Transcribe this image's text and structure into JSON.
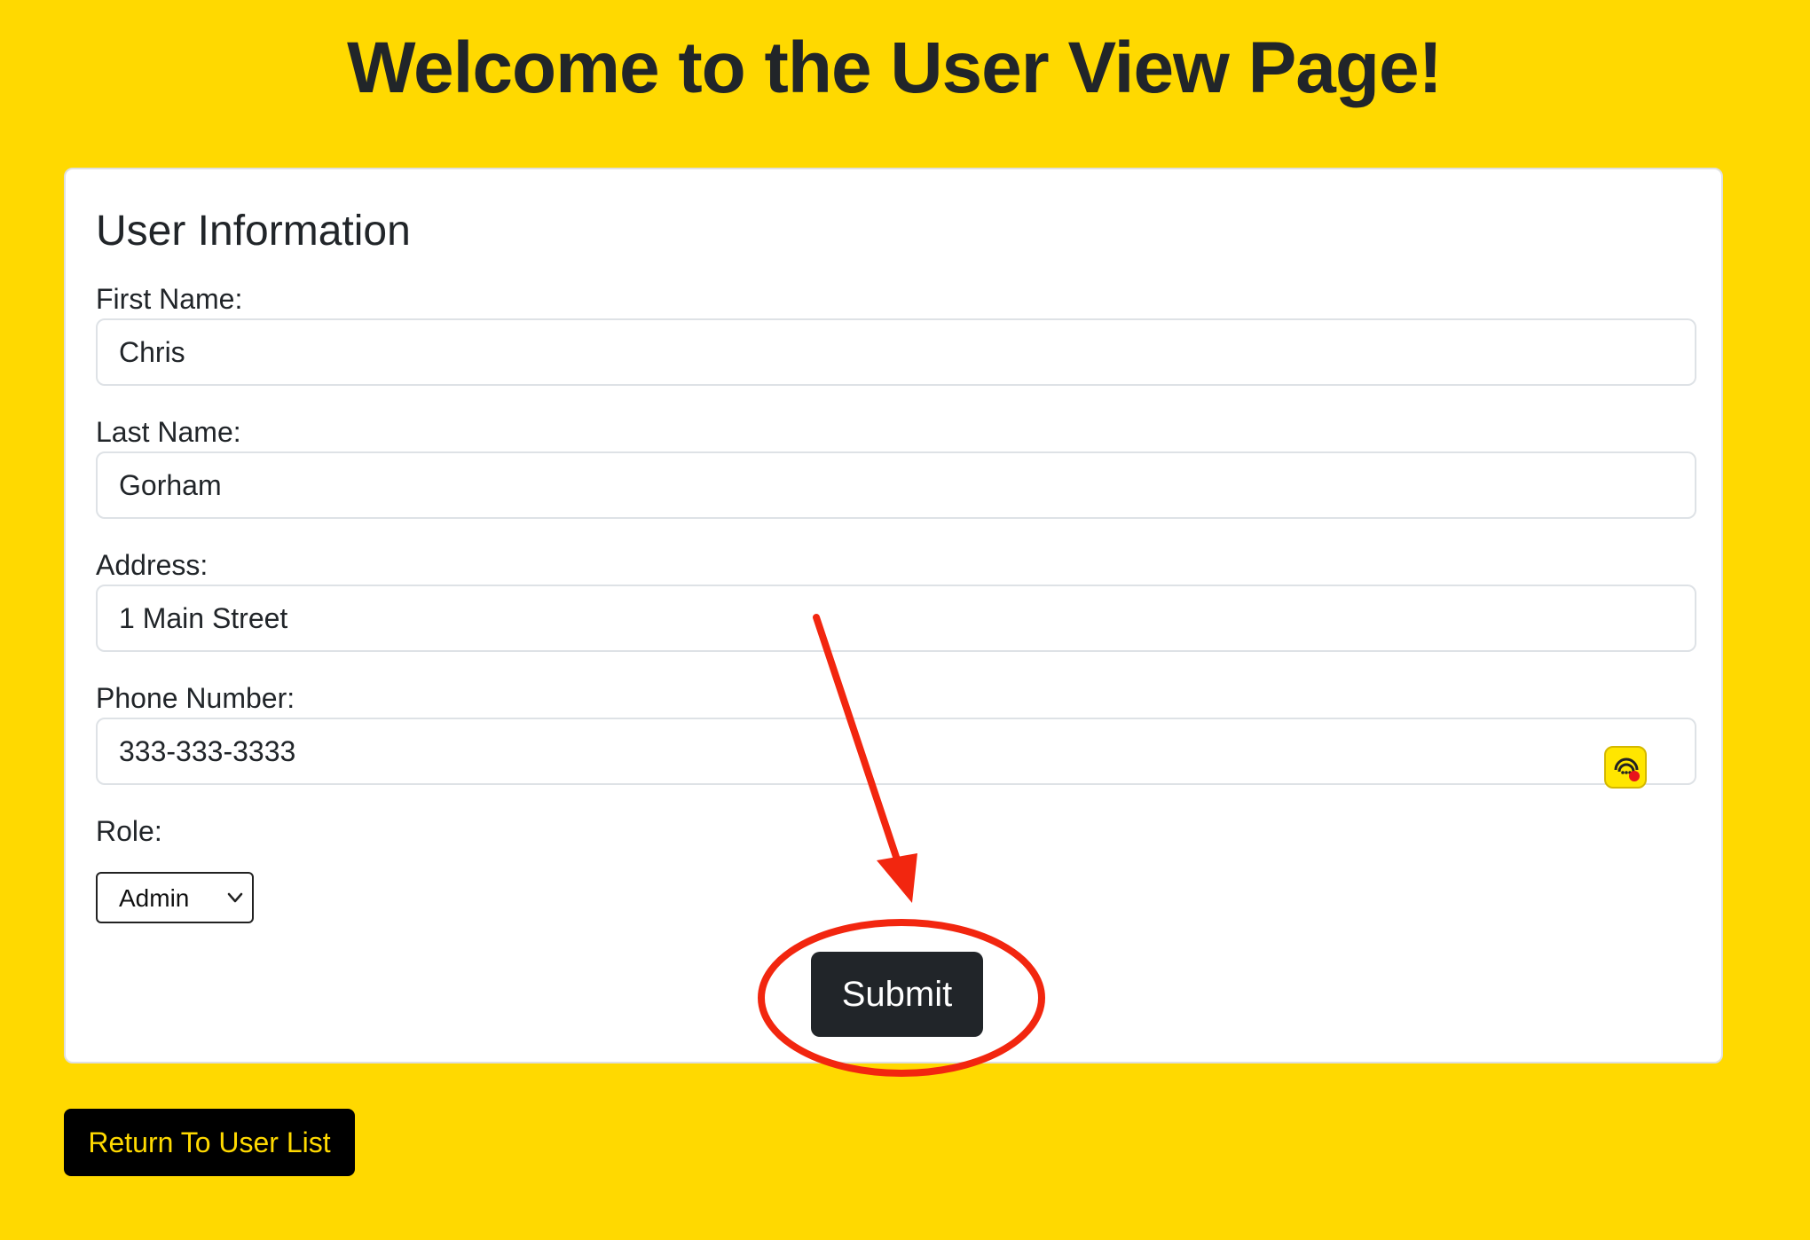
{
  "page": {
    "title": "Welcome to the User View Page!"
  },
  "card": {
    "title": "User Information",
    "fields": [
      {
        "label": "First Name:",
        "value": "Chris"
      },
      {
        "label": "Last Name:",
        "value": "Gorham"
      },
      {
        "label": "Address:",
        "value": "1 Main Street"
      },
      {
        "label": "Phone Number:",
        "value": "333-333-3333"
      }
    ],
    "role": {
      "label": "Role:",
      "selected": "Admin"
    },
    "submit_label": "Submit"
  },
  "footer": {
    "return_label": "Return To User List"
  },
  "colors": {
    "page_background": "#FFD900",
    "button_dark": "#212529",
    "return_button_bg": "#000000",
    "return_button_text": "#FFD900",
    "annotation_red": "#F2260F"
  },
  "icons": {
    "phone_field_extension": "chat-assistant-icon",
    "select_chevron": "chevron-down-icon"
  }
}
